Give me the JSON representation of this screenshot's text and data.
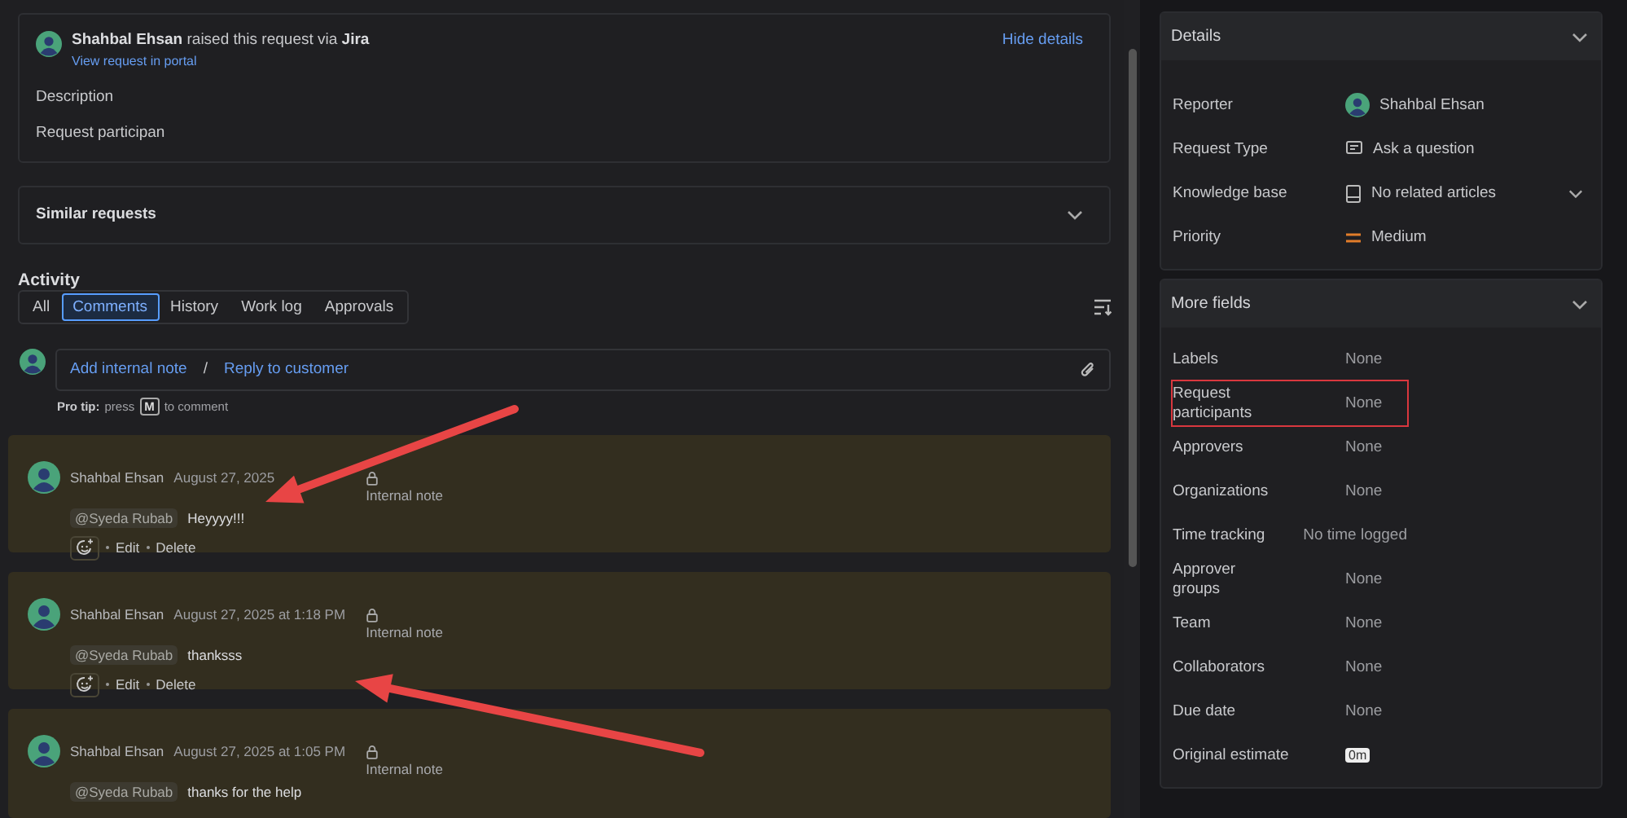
{
  "request": {
    "author": "Shahbal Ehsan",
    "action": "raised this request via",
    "source": "Jira",
    "portal_link": "View request in portal",
    "hide_link": "Hide details",
    "description_label": "Description",
    "description": "Request participan"
  },
  "similar": {
    "title": "Similar requests",
    "expanded": false
  },
  "activity": {
    "title": "Activity",
    "tabs": [
      {
        "label": "All",
        "selected": false
      },
      {
        "label": "Comments",
        "selected": true
      },
      {
        "label": "History",
        "selected": false
      },
      {
        "label": "Work log",
        "selected": false
      },
      {
        "label": "Approvals",
        "selected": false
      }
    ],
    "composer": {
      "internal": "Add internal note",
      "separator": "/",
      "reply": "Reply to customer"
    },
    "tip": {
      "label": "Pro tip:",
      "before": "press",
      "key": "M",
      "after": "to comment"
    },
    "comments": [
      {
        "author": "Shahbal Ehsan",
        "time": "August 27, 2025",
        "visibility": "Internal note",
        "mention": "@Syeda Rubab",
        "text": "Heyyyy!!!",
        "actions": [
          "Edit",
          "Delete"
        ]
      },
      {
        "author": "Shahbal Ehsan",
        "time": "August 27, 2025 at 1:18 PM",
        "visibility": "Internal note",
        "mention": "@Syeda Rubab",
        "text": "thanksss",
        "actions": [
          "Edit",
          "Delete"
        ]
      },
      {
        "author": "Shahbal Ehsan",
        "time": "August 27, 2025 at 1:05 PM",
        "visibility": "Internal note",
        "mention": "@Syeda Rubab",
        "text": "thanks for the help"
      }
    ]
  },
  "annotation_arrows": [
    {
      "kind": "arrow"
    },
    {
      "kind": "arrow"
    }
  ],
  "details": {
    "title": "Details",
    "fields": [
      {
        "label": "Reporter",
        "value": "Shahbal Ehsan",
        "kind": "person"
      },
      {
        "label": "Request Type",
        "value": "Ask a question",
        "kind": "type"
      },
      {
        "label": "Knowledge base",
        "value": "No related articles",
        "kind": "kb"
      },
      {
        "label": "Priority",
        "value": "Medium",
        "kind": "priority"
      }
    ]
  },
  "more_fields": {
    "title": "More fields",
    "fields": [
      {
        "label": "Labels",
        "value": "None",
        "highlighted": false,
        "kind": "text"
      },
      {
        "label": "Request participants",
        "value": "None",
        "highlighted": true,
        "kind": "text"
      },
      {
        "label": "Approvers",
        "value": "None",
        "highlighted": false,
        "kind": "text"
      },
      {
        "label": "Organizations",
        "value": "None",
        "highlighted": false,
        "kind": "text"
      },
      {
        "label": "Time tracking",
        "value": "No time logged",
        "highlighted": false,
        "kind": "text"
      },
      {
        "label": "Approver groups",
        "value": "None",
        "highlighted": false,
        "kind": "text"
      },
      {
        "label": "Team",
        "value": "None",
        "highlighted": false,
        "kind": "text"
      },
      {
        "label": "Collaborators",
        "value": "None",
        "highlighted": false,
        "kind": "text"
      },
      {
        "label": "Due date",
        "value": "None",
        "highlighted": false,
        "kind": "text"
      },
      {
        "label": "Original estimate",
        "value": "0m",
        "highlighted": false,
        "kind": "tag"
      }
    ]
  }
}
